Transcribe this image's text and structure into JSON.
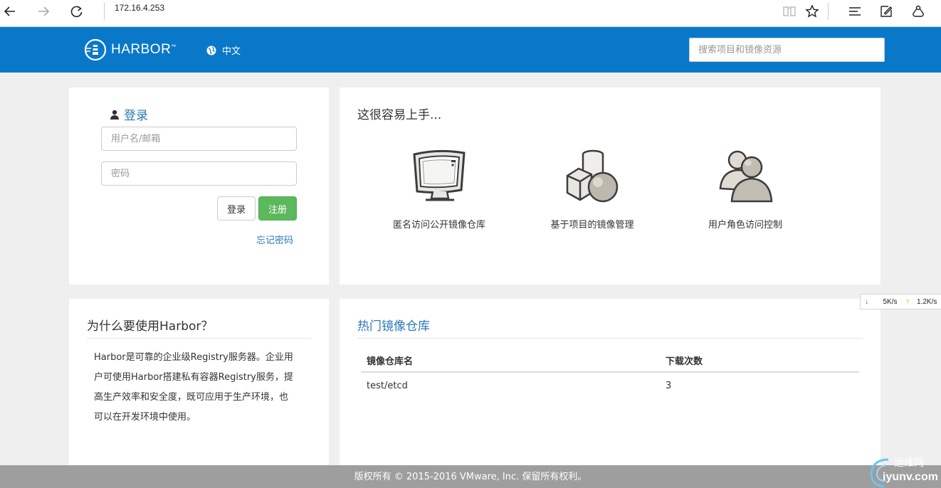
{
  "browser": {
    "address": "172.16.4.253"
  },
  "header": {
    "logo_text": "HARBOR",
    "logo_tm": "™",
    "language": "中文",
    "search_placeholder": "搜索项目和镜像资源",
    "color": "#0a78c8"
  },
  "login": {
    "title": "登录",
    "username_placeholder": "用户名/邮箱",
    "password_placeholder": "密码",
    "login_button": "登录",
    "register_button": "注册",
    "forgot_password": "忘记密码"
  },
  "getting_started": {
    "title": "这很容易上手...",
    "features": [
      {
        "label": "匿名访问公开镜像仓库",
        "icon": "monitor-icon"
      },
      {
        "label": "基于项目的镜像管理",
        "icon": "shapes-icon"
      },
      {
        "label": "用户角色访问控制",
        "icon": "users-icon"
      }
    ]
  },
  "why": {
    "title": "为什么要使用Harbor？",
    "lines": [
      "Harbor是可靠的企业级Registry服务器。企业用",
      "户可使用Harbor搭建私有容器Registry服务，提",
      "高生产效率和安全度，既可应用于生产环境，也",
      "可以在开发环境中使用。"
    ]
  },
  "popular_repos": {
    "title": "热门镜像仓库",
    "columns": [
      "镜像仓库名",
      "下载次数"
    ],
    "rows": [
      {
        "name": "test/etcd",
        "downloads": "3"
      }
    ]
  },
  "footer": {
    "text": "版权所有 © 2015-2016 VMware, Inc. 保留所有权利。"
  },
  "net_widget": {
    "down": "5K/s",
    "up": "1.2K/s"
  },
  "watermark": {
    "cn": "运维网",
    "en": "iyunv.com"
  }
}
